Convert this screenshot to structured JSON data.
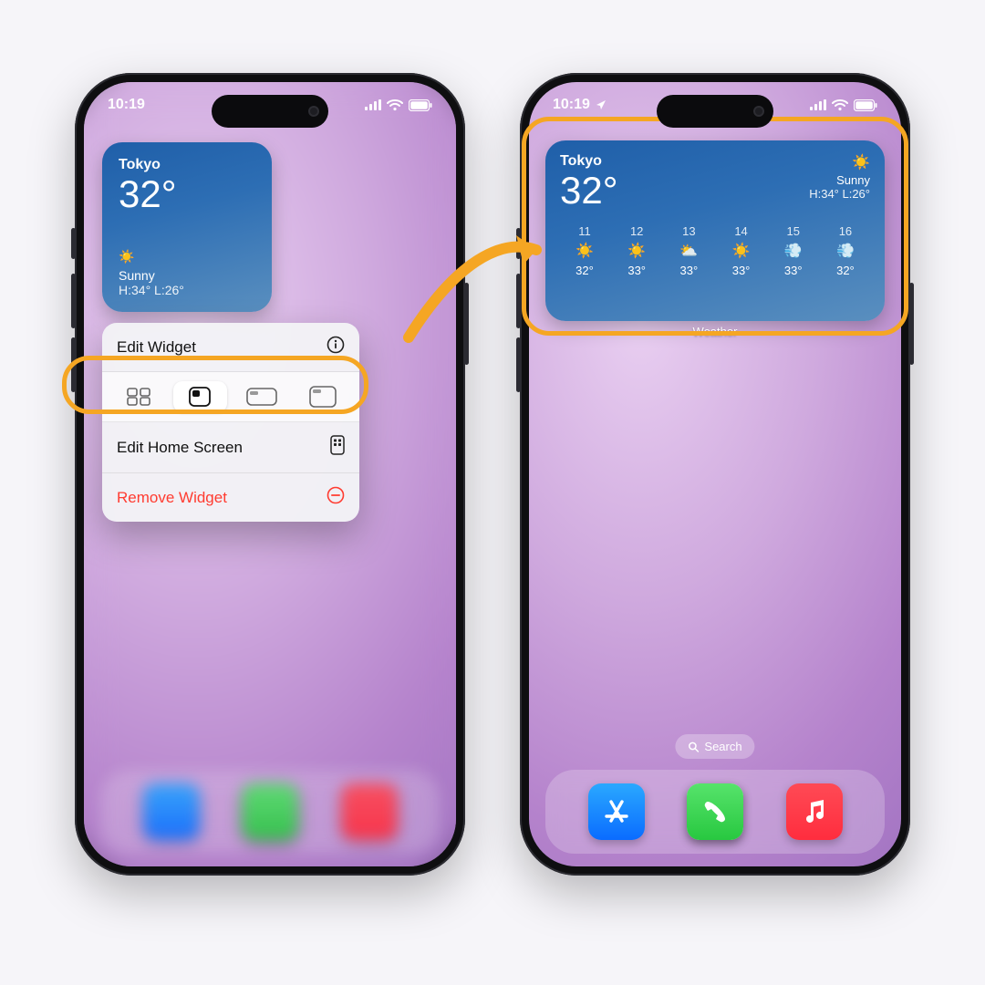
{
  "statusbar": {
    "time": "10:19"
  },
  "weather": {
    "city": "Tokyo",
    "temp": "32°",
    "condition": "Sunny",
    "hilo": "H:34° L:26°",
    "caption": "Weather",
    "hourly": [
      {
        "hour": "11",
        "icon": "☀️",
        "temp": "32°"
      },
      {
        "hour": "12",
        "icon": "☀️",
        "temp": "33°"
      },
      {
        "hour": "13",
        "icon": "⛅",
        "temp": "33°"
      },
      {
        "hour": "14",
        "icon": "☀️",
        "temp": "33°"
      },
      {
        "hour": "15",
        "icon": "💨",
        "temp": "33°"
      },
      {
        "hour": "16",
        "icon": "💨",
        "temp": "32°"
      }
    ]
  },
  "context_menu": {
    "edit_widget": "Edit Widget",
    "edit_home": "Edit Home Screen",
    "remove": "Remove Widget"
  },
  "search": {
    "label": "Search"
  },
  "colors": {
    "highlight": "#f5a623",
    "danger": "#ff3b30"
  }
}
